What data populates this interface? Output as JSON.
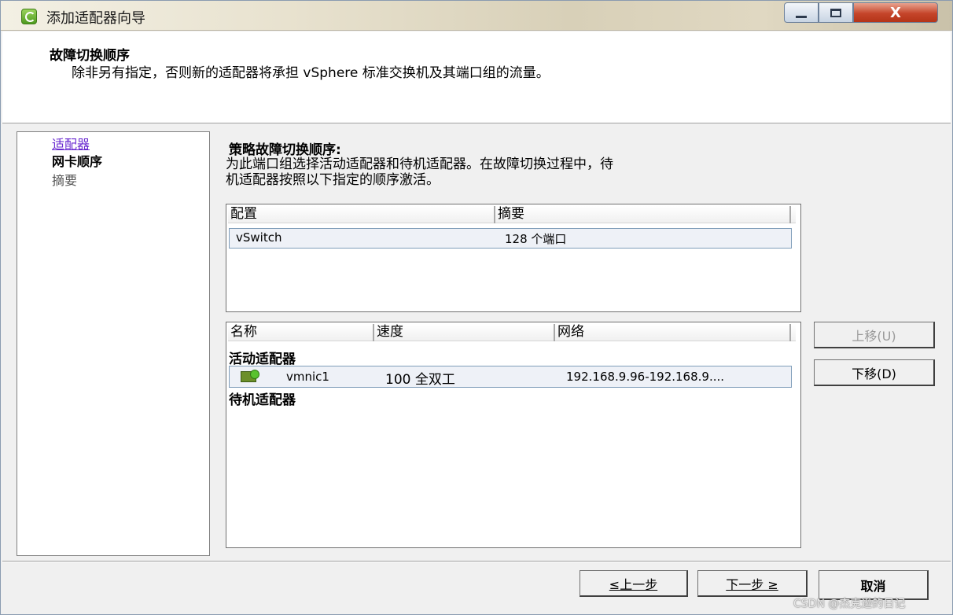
{
  "window": {
    "title": "添加适配器向导",
    "close_glyph": "X"
  },
  "header": {
    "title": "故障切换顺序",
    "description": "除非另有指定，否则新的适配器将承担 vSphere 标准交换机及其端口组的流量。"
  },
  "nav": {
    "items": [
      {
        "label": "适配器",
        "state": "visited"
      },
      {
        "label": "网卡顺序",
        "state": "current"
      },
      {
        "label": "摘要",
        "state": "pending"
      }
    ]
  },
  "policy": {
    "title": "策略故障切换顺序:",
    "description_line1": "为此端口组选择活动适配器和待机适配器。在故障切换过程中，待",
    "description_line2": "机适配器按照以下指定的顺序激活。"
  },
  "config_list": {
    "columns": [
      "配置",
      "摘要"
    ],
    "rows": [
      {
        "config": "vSwitch",
        "summary": "128 个端口"
      }
    ]
  },
  "adapter_list": {
    "columns": [
      "名称",
      "速度",
      "网络"
    ],
    "active_label": "活动适配器",
    "standby_label": "待机适配器",
    "active": [
      {
        "name": "vmnic1",
        "speed": "100 全双工",
        "network": "192.168.9.96-192.168.9...."
      }
    ]
  },
  "buttons": {
    "move_up": "上移(U)",
    "move_down": "下移(D)",
    "back": "≤上一步",
    "next": "下一步 ≥",
    "cancel": "取消"
  },
  "watermark": "CSDN @杰克逊的日记"
}
